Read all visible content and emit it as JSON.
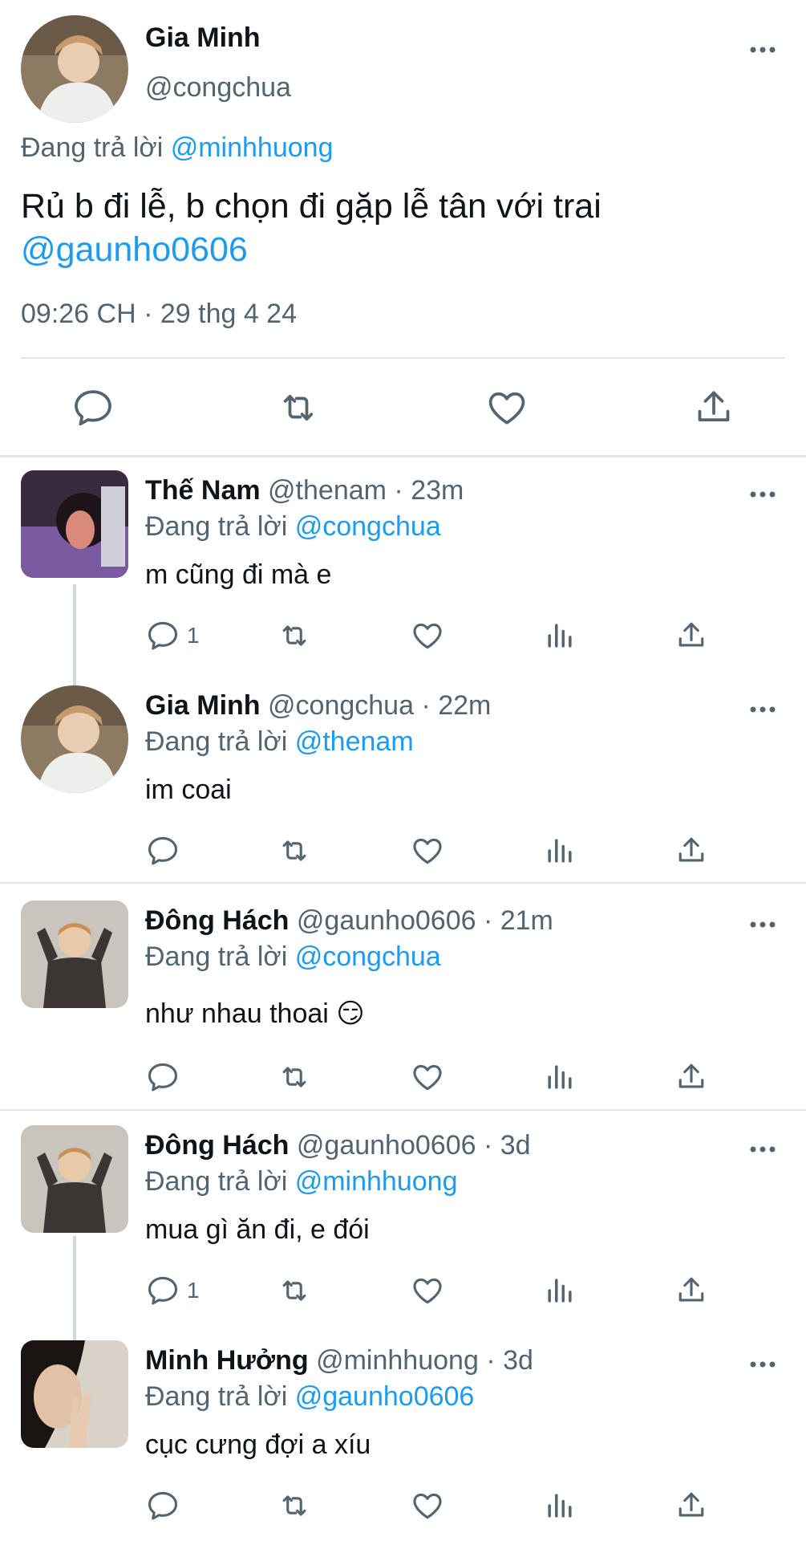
{
  "main": {
    "name": "Gia Minh",
    "handle": "@congchua",
    "replying_prefix": "Đang trả lời",
    "replying_to": "@minhhuong",
    "text": "Rủ b đi lễ, b chọn đi gặp lễ tân với trai",
    "mention": "@gaunho0606",
    "timestamp": "09:26 CH · 29 thg 4 24"
  },
  "replies": [
    {
      "name": "Thế Nam",
      "handle": "@thenam",
      "time": "· 23m",
      "replying_prefix": "Đang trả lời",
      "replying_to": "@congchua",
      "text": "m cũng đi mà e",
      "reply_count": "1"
    },
    {
      "name": "Gia Minh",
      "handle": "@congchua",
      "time": "· 22m",
      "replying_prefix": "Đang trả lời",
      "replying_to": "@thenam",
      "text": "im coai",
      "reply_count": ""
    },
    {
      "name": "Đông Hách",
      "handle": "@gaunho0606",
      "time": "· 21m",
      "replying_prefix": "Đang trả lời",
      "replying_to": "@congchua",
      "text": "như nhau thoai 😏",
      "reply_count": ""
    },
    {
      "name": "Đông Hách",
      "handle": "@gaunho0606",
      "time": "· 3d",
      "replying_prefix": "Đang trả lời",
      "replying_to": "@minhhuong",
      "text": "mua gì ăn đi, e đói",
      "reply_count": "1"
    },
    {
      "name": "Minh Hưởng",
      "handle": "@minhhuong",
      "time": "· 3d",
      "replying_prefix": "Đang trả lời",
      "replying_to": "@gaunho0606",
      "text": "cục cưng đợi a xíu",
      "reply_count": ""
    }
  ],
  "icons": [
    "reply-icon",
    "retweet-icon",
    "like-icon",
    "views-icon",
    "share-icon",
    "more-icon"
  ],
  "colors": {
    "link": "#1d9bf0",
    "secondary": "#536471",
    "divider": "#e3e6e8"
  }
}
